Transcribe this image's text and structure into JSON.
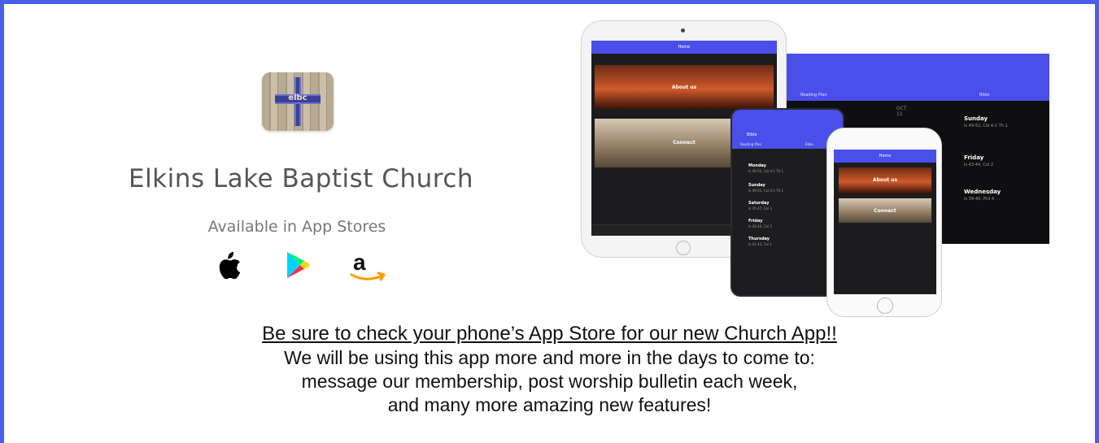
{
  "church": {
    "name": "Elkins Lake Baptist Church",
    "logo_text": "elbc"
  },
  "stores": {
    "label": "Available in App Stores",
    "icons": [
      "apple-icon",
      "google-play-icon",
      "amazon-icon"
    ]
  },
  "mockup": {
    "tablet": {
      "title": "Home",
      "card1": "About us",
      "card2": "Connect"
    },
    "landscape": {
      "tab1": "Reading Plan",
      "tab2": "Bible",
      "date_month": "OCT",
      "date_day": "11",
      "rows": [
        {
          "title": "Sunday",
          "sub": "Is 49-52, Col 4-1 Th 1"
        },
        {
          "title": "Friday",
          "sub": "Is 43-44, Col 2"
        },
        {
          "title": "Wednesday",
          "sub": "Is 39-40, Phil 4"
        }
      ]
    },
    "android": {
      "title": "Bible",
      "tab1": "Reading Plan",
      "tab2": "Bible",
      "items": [
        {
          "title": "Monday",
          "sub": "Is 49-52, Col 4-1 Th 1"
        },
        {
          "title": "Sunday",
          "sub": "Is 49-52, Col 4-1 Th 1"
        },
        {
          "title": "Saturday",
          "sub": "Is 45-47, Col 3"
        },
        {
          "title": "Friday",
          "sub": "Is 43-44, Col 2"
        },
        {
          "title": "Thursday",
          "sub": "Is 41-42, Col 1"
        }
      ]
    },
    "iphone": {
      "title": "Home",
      "card1": "About us",
      "card2": "Connect"
    }
  },
  "message": {
    "headline": "Be sure to check your phone’s App Store for our new Church App!!",
    "line1": "We will be using this app more and more in the days to come to:",
    "line2": "message our membership, post worship bulletin each week,",
    "line3": "and many more amazing new features!"
  },
  "colors": {
    "border": "#4a5fe8",
    "app_accent": "#4a4fea",
    "amazon_orange": "#f90"
  }
}
